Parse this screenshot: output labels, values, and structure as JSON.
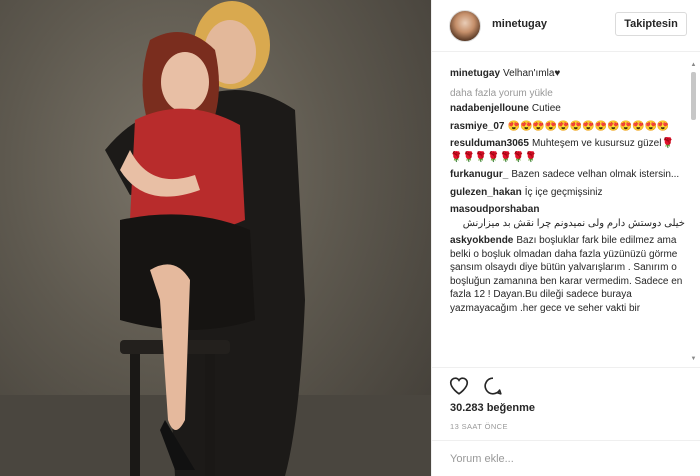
{
  "post": {
    "username": "minetugay",
    "follow_label": "Takiptesin",
    "caption_user": "minetugay",
    "caption_text": "Velhan'ımla♥",
    "load_more": "daha fazla yorum yükle",
    "likes": "30.283 beğenme",
    "time": "13 SAAT ÖNCE",
    "comment_placeholder": "Yorum ekle..."
  },
  "comments": [
    {
      "user": "nadabenjelloune",
      "text": "Cutiee"
    },
    {
      "user": "rasmiye_07",
      "text": "😍😍😍😍😍😍😍😍😍😍😍😍😍"
    },
    {
      "user": "resulduman3065",
      "text": "Muhteşem ve kusursuz güzel🌹🌹🌹🌹🌹🌹🌹🌹"
    },
    {
      "user": "furkanugur_",
      "text": "Bazen sadece velhan olmak istersin..."
    },
    {
      "user": "gulezen_hakan",
      "text": "İç içe geçmişsiniz"
    },
    {
      "user": "masoudporshaban",
      "text": "خیلی دوستش دارم ولی نمیدونم چرا نقش بد میزارنش"
    },
    {
      "user": "askyokbende",
      "text": "Bazı boşluklar fark bile edilmez ama belki o boşluk olmadan daha fazla yüzünüzü görme şansım olsaydı diye bütün yalvarışlarım . Sanırım o boşluğun zamanına ben karar vermedim. Sadece en fazla 12 ! Dayan.Bu dileği sadece buraya yazmayacağım .her gece ve seher vakti bir"
    }
  ],
  "icons": {
    "heart": "heart-icon",
    "comment": "comment-icon",
    "scroll_up": "chevron-up-icon",
    "scroll_down": "chevron-down-icon"
  },
  "colors": {
    "background": "#ffffff",
    "text": "#262626",
    "muted": "#999999",
    "border": "#efefef"
  }
}
